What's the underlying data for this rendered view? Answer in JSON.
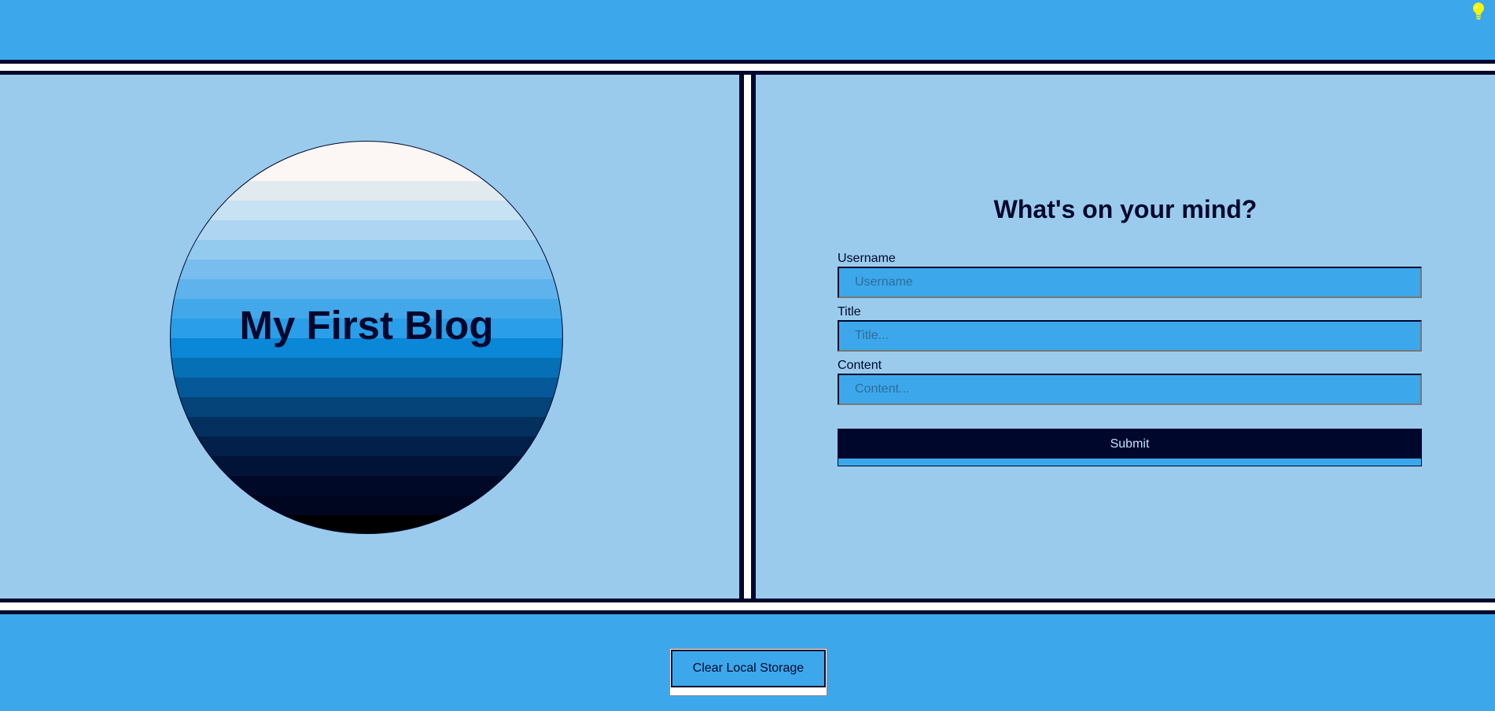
{
  "header": {
    "theme_toggle_icon": "lightbulb-icon",
    "bulb_color": "#f5f50a"
  },
  "hero": {
    "title": "My First Blog"
  },
  "form": {
    "heading": "What's on your mind?",
    "username_label": "Username",
    "username_placeholder": "Username",
    "title_label": "Title",
    "title_placeholder": "Title...",
    "content_label": "Content",
    "content_placeholder": "Content...",
    "submit_label": "Submit"
  },
  "footer": {
    "clear_label": "Clear Local Storage"
  },
  "colors": {
    "primary": "#3ca8eb",
    "panel": "#9acbec",
    "dark": "#00072d"
  }
}
